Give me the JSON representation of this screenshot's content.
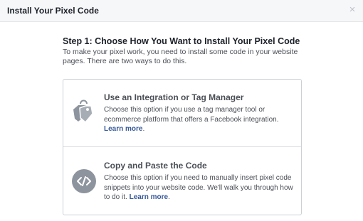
{
  "dialog": {
    "title": "Install Your Pixel Code",
    "close_label": "×"
  },
  "step": {
    "title": "Step 1: Choose How You Want to Install Your Pixel Code",
    "description": "To make your pixel work, you need to install some code in your website pages. There are two ways to do this."
  },
  "options": [
    {
      "icon": "tags-icon",
      "title": "Use an Integration or Tag Manager",
      "description": "Choose this option if you use a tag manager tool or ecommerce platform that offers a Facebook integration.",
      "link_label": "Learn more",
      "trailing": "."
    },
    {
      "icon": "code-icon",
      "title": "Copy and Paste the Code",
      "description": "Choose this option if you need to manually insert pixel code snippets into your website code. We'll walk you through how to do it.",
      "link_label": "Learn more",
      "trailing": "."
    }
  ],
  "colors": {
    "link": "#365899",
    "icon": "#8d949e",
    "header_bg": "#f6f7f9",
    "border": "#ccd0d5"
  }
}
